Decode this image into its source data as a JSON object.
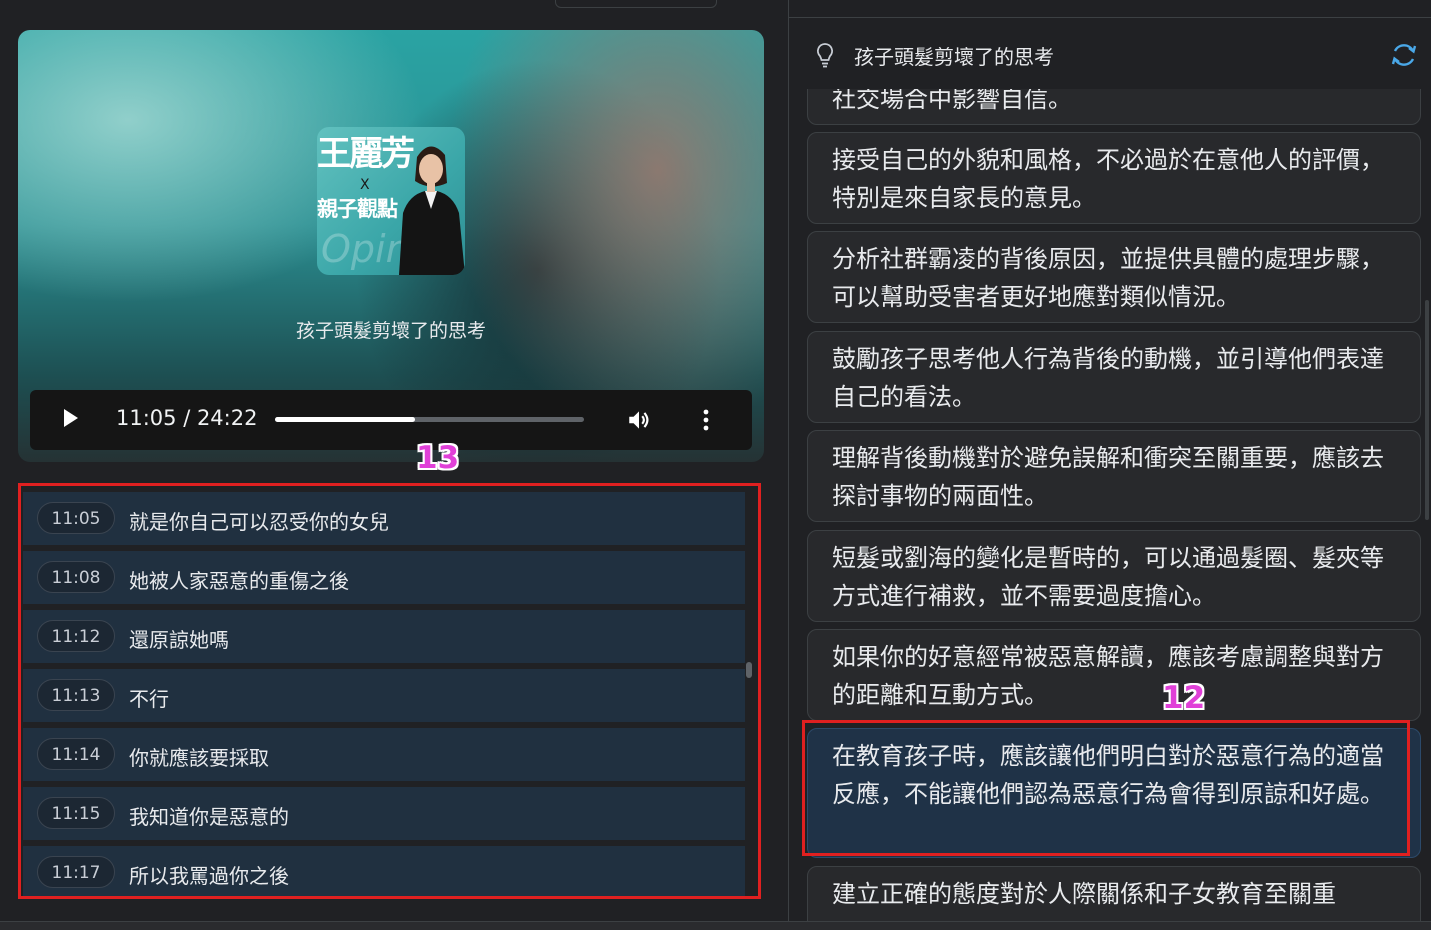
{
  "video": {
    "thumbnail": {
      "title_line1": "王麗芳",
      "title_x": "X",
      "title_line2": "親子觀點",
      "watermark": "Opinio"
    },
    "title": "孩子頭髮剪壞了的思考",
    "time_display": "11:05 / 24:22",
    "progress_fraction": 0.454,
    "icons": {
      "play": "play-icon",
      "volume": "volume-icon",
      "more": "more-vert-icon"
    }
  },
  "transcript": {
    "rows": [
      {
        "time": "11:05",
        "text": "就是你自己可以忍受你的女兒"
      },
      {
        "time": "11:08",
        "text": "她被人家惡意的重傷之後"
      },
      {
        "time": "11:12",
        "text": "還原諒她嗎"
      },
      {
        "time": "11:13",
        "text": "不行"
      },
      {
        "time": "11:14",
        "text": "你就應該要採取"
      },
      {
        "time": "11:15",
        "text": "我知道你是惡意的"
      },
      {
        "time": "11:17",
        "text": "所以我罵過你之後"
      }
    ]
  },
  "annotations": {
    "left_marker": "13",
    "right_marker": "12",
    "color": "#e02020"
  },
  "panel": {
    "title": "孩子頭髮剪壞了的思考",
    "icons": {
      "bulb": "lightbulb-icon",
      "refresh": "refresh-icon"
    },
    "partial_top": "社交場合中影響自信。",
    "cards": [
      "接受自己的外貌和風格，不必過於在意他人的評價，特別是來自家長的意見。",
      "分析社群霸凌的背後原因，並提供具體的處理步驟，可以幫助受害者更好地應對類似情況。",
      "鼓勵孩子思考他人行為背後的動機，並引導他們表達自己的看法。",
      "理解背後動機對於避免誤解和衝突至關重要，應該去探討事物的兩面性。",
      "短髮或劉海的變化是暫時的，可以通過髮圈、髮夾等方式進行補救，並不需要過度擔心。",
      "如果你的好意經常被惡意解讀，應該考慮調整與對方的距離和互動方式。",
      "在教育孩子時，應該讓他們明白對於惡意行為的適當反應，不能讓他們認為惡意行為會得到原諒和好處。",
      "建立正確的態度對於人際關係和子女教育至關重"
    ]
  }
}
